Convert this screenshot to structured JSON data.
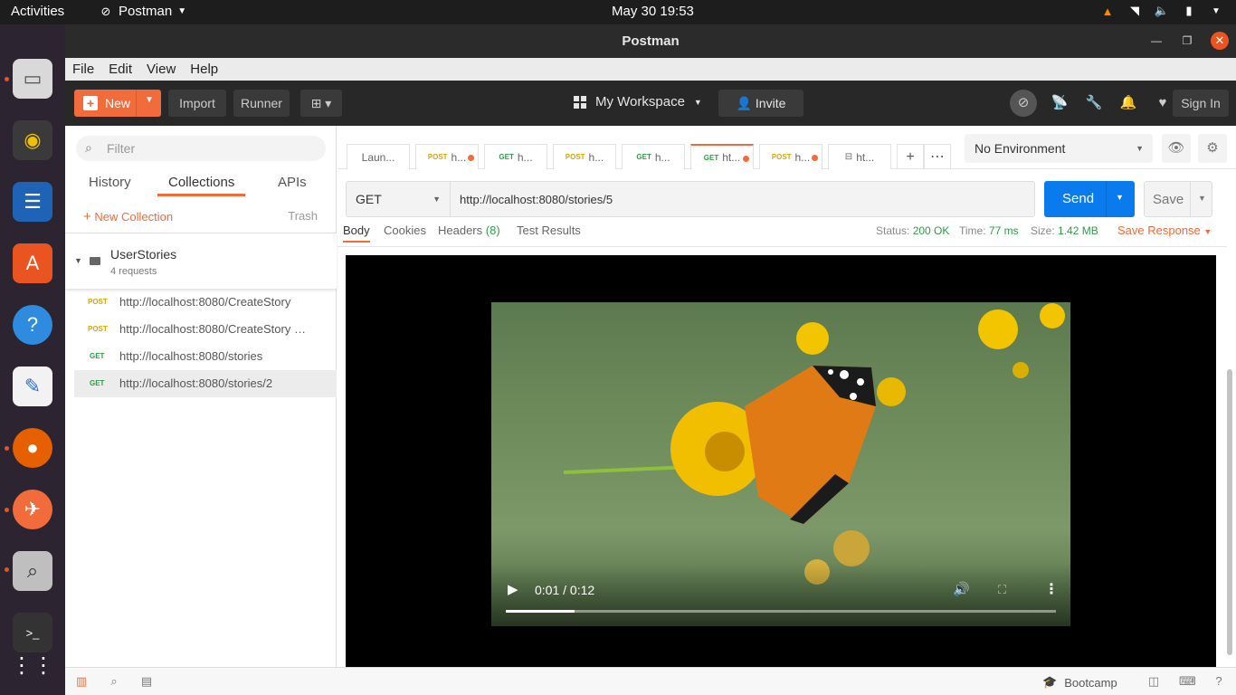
{
  "system": {
    "activities": "Activities",
    "app_name": "Postman",
    "clock": "May 30  19:53"
  },
  "window": {
    "title": "Postman"
  },
  "menu": [
    "File",
    "Edit",
    "View",
    "Help"
  ],
  "header": {
    "new_label": "New",
    "import_label": "Import",
    "runner_label": "Runner",
    "workspace_label": "My Workspace",
    "invite_label": "Invite",
    "signin_label": "Sign In"
  },
  "sidebar": {
    "filter_placeholder": "Filter",
    "tabs": [
      "History",
      "Collections",
      "APIs"
    ],
    "active_tab": "Collections",
    "new_collection_label": "New Collection",
    "trash_label": "Trash",
    "collection": {
      "name": "UserStories",
      "count": "4 requests",
      "requests": [
        {
          "method": "POST",
          "url": "http://localhost:8080/CreateStory"
        },
        {
          "method": "POST",
          "url": "http://localhost:8080/CreateStory C..."
        },
        {
          "method": "GET",
          "url": "http://localhost:8080/stories"
        },
        {
          "method": "GET",
          "url": "http://localhost:8080/stories/2"
        }
      ]
    }
  },
  "request_tabs": [
    {
      "method": "",
      "label": "Laun...",
      "dirty": false
    },
    {
      "method": "POST",
      "label": "h...",
      "dirty": true
    },
    {
      "method": "GET",
      "label": "h...",
      "dirty": false
    },
    {
      "method": "POST",
      "label": "h...",
      "dirty": false
    },
    {
      "method": "GET",
      "label": "h...",
      "dirty": false
    },
    {
      "method": "GET",
      "label": "ht...",
      "dirty": true,
      "active": true
    },
    {
      "method": "POST",
      "label": "h...",
      "dirty": true
    },
    {
      "method": "",
      "label": "ht...",
      "dirty": false
    }
  ],
  "environment": {
    "selected": "No Environment"
  },
  "request": {
    "method": "GET",
    "url": "http://localhost:8080/stories/5",
    "send_label": "Send",
    "save_label": "Save"
  },
  "response": {
    "tabs": {
      "body": "Body",
      "cookies": "Cookies",
      "headers": "Headers",
      "headers_count": "(8)",
      "test_results": "Test Results"
    },
    "status_label": "Status:",
    "status_value": "200 OK",
    "time_label": "Time:",
    "time_value": "77 ms",
    "size_label": "Size:",
    "size_value": "1.42 MB",
    "save_response_label": "Save Response"
  },
  "video": {
    "time": "0:01 / 0:12",
    "progress_fraction": 0.125
  },
  "statusbar": {
    "bootcamp_label": "Bootcamp"
  },
  "colors": {
    "accent": "#f26b3a",
    "send": "#097bed",
    "get": "#2f9b48",
    "post": "#e0a400"
  }
}
